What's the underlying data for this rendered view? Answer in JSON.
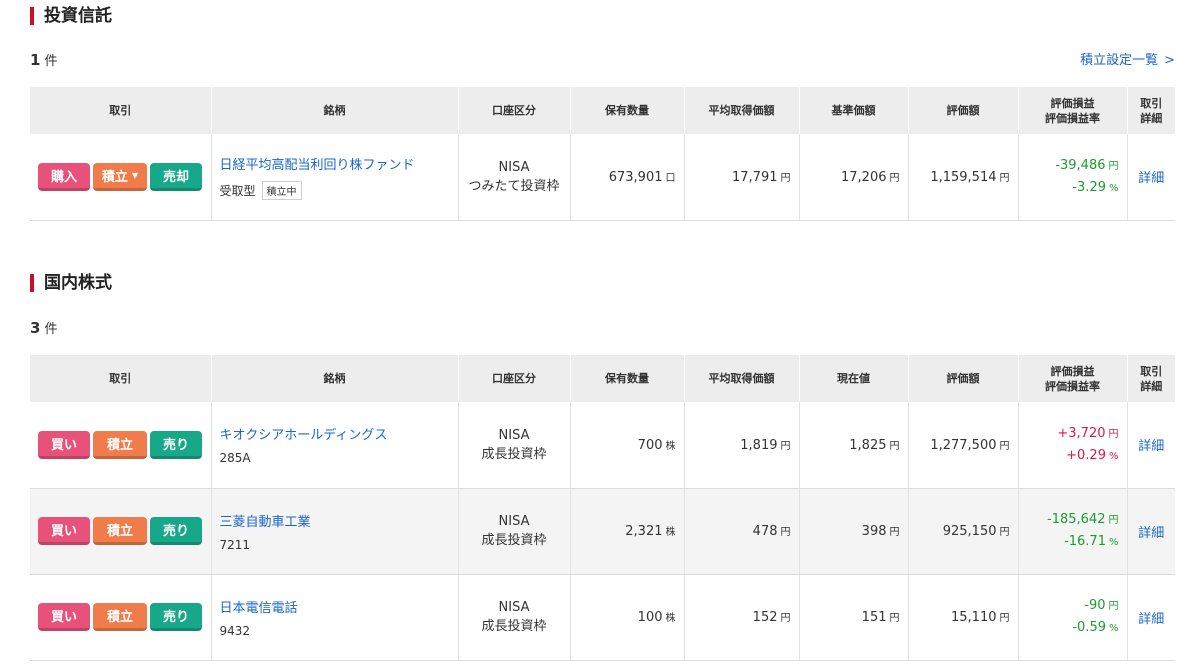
{
  "funds": {
    "title": "投資信託",
    "count_num": "1",
    "count_unit": "件",
    "setup_link": "積立設定一覧",
    "headers": [
      "取引",
      "銘柄",
      "口座区分",
      "保有数量",
      "平均取得価額",
      "基準価額",
      "評価額",
      "評価損益",
      "評価損益率",
      "取引",
      "詳細"
    ],
    "rows": [
      {
        "buy": "購入",
        "accum": "積立",
        "sell": "売却",
        "name": "日経平均高配当利回り株ファンド",
        "sub": "受取型",
        "tag": "積立中",
        "account1": "NISA",
        "account2": "つみたて投資枠",
        "qty": "673,901",
        "qty_unit": "口",
        "avg": "17,791",
        "avg_unit": "円",
        "price": "17,206",
        "price_unit": "円",
        "value": "1,159,514",
        "value_unit": "円",
        "pl": "-39,486",
        "pl_unit": "円",
        "plr": "-3.29",
        "plr_unit": "%",
        "detail": "詳細"
      }
    ]
  },
  "stocks": {
    "title": "国内株式",
    "count_num": "3",
    "count_unit": "件",
    "headers": [
      "取引",
      "銘柄",
      "口座区分",
      "保有数量",
      "平均取得価額",
      "現在値",
      "評価額",
      "評価損益",
      "評価損益率",
      "取引",
      "詳細"
    ],
    "rows": [
      {
        "buy": "買い",
        "accum": "積立",
        "sell": "売り",
        "name": "キオクシアホールディングス",
        "code": "285A",
        "account1": "NISA",
        "account2": "成長投資枠",
        "qty": "700",
        "qty_unit": "株",
        "avg": "1,819",
        "avg_unit": "円",
        "price": "1,825",
        "price_unit": "円",
        "value": "1,277,500",
        "value_unit": "円",
        "pl": "+3,720",
        "pl_unit": "円",
        "plr": "+0.29",
        "plr_unit": "%",
        "detail": "詳細"
      },
      {
        "buy": "買い",
        "accum": "積立",
        "sell": "売り",
        "name": "三菱自動車工業",
        "code": "7211",
        "account1": "NISA",
        "account2": "成長投資枠",
        "qty": "2,321",
        "qty_unit": "株",
        "avg": "478",
        "avg_unit": "円",
        "price": "398",
        "price_unit": "円",
        "value": "925,150",
        "value_unit": "円",
        "pl": "-185,642",
        "pl_unit": "円",
        "plr": "-16.71",
        "plr_unit": "%",
        "detail": "詳細"
      },
      {
        "buy": "買い",
        "accum": "積立",
        "sell": "売り",
        "name": "日本電信電話",
        "code": "9432",
        "account1": "NISA",
        "account2": "成長投資枠",
        "qty": "100",
        "qty_unit": "株",
        "avg": "152",
        "avg_unit": "円",
        "price": "151",
        "price_unit": "円",
        "value": "15,110",
        "value_unit": "円",
        "pl": "-90",
        "pl_unit": "円",
        "plr": "-0.59",
        "plr_unit": "%",
        "detail": "詳細"
      }
    ]
  }
}
